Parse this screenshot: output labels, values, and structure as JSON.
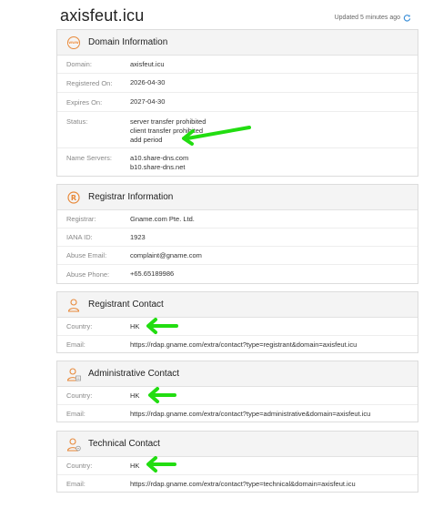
{
  "domain": "axisfeut.icu",
  "updated": "Updated 5 minutes ago",
  "domain_info": {
    "title": "Domain Information",
    "domain_label": "Domain:",
    "domain_value": "axisfeut.icu",
    "registered_label": "Registered On:",
    "registered_value": "2026-04-30",
    "expires_label": "Expires On:",
    "expires_value": "2027-04-30",
    "status_label": "Status:",
    "status_values": [
      "server transfer prohibited",
      "client transfer prohibited",
      "add period"
    ],
    "ns_label": "Name Servers:",
    "ns_values": [
      "a10.share-dns.com",
      "b10.share-dns.net"
    ]
  },
  "registrar_info": {
    "title": "Registrar Information",
    "registrar_label": "Registrar:",
    "registrar_value": "Gname.com Pte. Ltd.",
    "iana_label": "IANA ID:",
    "iana_value": "1923",
    "abuse_email_label": "Abuse Email:",
    "abuse_email_value": "complaint@gname.com",
    "abuse_phone_label": "Abuse Phone:",
    "abuse_phone_value": "+65.65189986"
  },
  "registrant": {
    "title": "Registrant Contact",
    "country_label": "Country:",
    "country_value": "HK",
    "email_label": "Email:",
    "email_value": "https://rdap.gname.com/extra/contact?type=registrant&domain=axisfeut.icu"
  },
  "administrative": {
    "title": "Administrative Contact",
    "country_label": "Country:",
    "country_value": "HK",
    "email_label": "Email:",
    "email_value": "https://rdap.gname.com/extra/contact?type=administrative&domain=axisfeut.icu"
  },
  "technical": {
    "title": "Technical Contact",
    "country_label": "Country:",
    "country_value": "HK",
    "email_label": "Email:",
    "email_value": "https://rdap.gname.com/extra/contact?type=technical&domain=axisfeut.icu"
  },
  "colors": {
    "accent": "#e8893a",
    "arrow": "#22dd11",
    "refresh": "#3a8fd8"
  },
  "icons": [
    "www-icon",
    "registered-icon",
    "person-icon",
    "admin-person-icon",
    "tech-person-icon",
    "refresh-icon"
  ]
}
